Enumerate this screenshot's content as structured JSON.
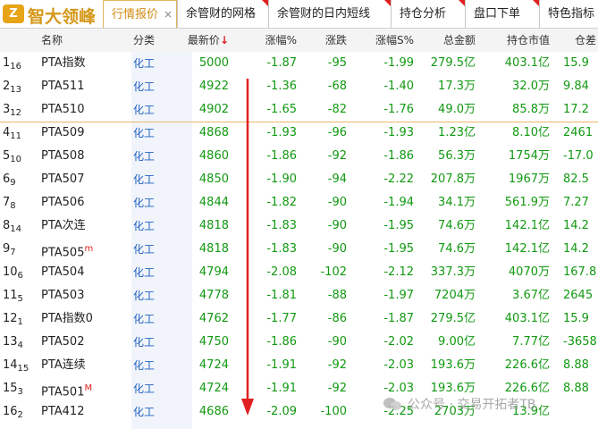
{
  "app": {
    "logo_glyph": "Z",
    "logo_text": "智大领峰"
  },
  "tabs": [
    {
      "label": "行情报价",
      "active": true,
      "close": "×"
    },
    {
      "label": "余管财的网格",
      "active": false
    },
    {
      "label": "余管财的日内短线",
      "active": false
    },
    {
      "label": "持仓分析",
      "active": false
    },
    {
      "label": "盘口下单",
      "active": false
    },
    {
      "label": "特色指标",
      "active": false
    }
  ],
  "columns": {
    "name": "名称",
    "category": "分类",
    "price": "最新价",
    "price_sort": "↓",
    "change_pct": "涨幅%",
    "change": "涨跌",
    "change_pct_s": "涨幅S%",
    "amount": "总金额",
    "position_value": "持仓市值",
    "open_diff": "仓差"
  },
  "rows": [
    {
      "idx": "1",
      "sub": "16",
      "name": "PTA指数",
      "sup": "",
      "cat": "化工",
      "price": "5000",
      "chg_pct": "-1.87",
      "chg": "-95",
      "chg_pct_s": "-1.99",
      "amount": "279.5亿",
      "pos_value": "403.1亿",
      "open_diff": "15.9"
    },
    {
      "idx": "2",
      "sub": "13",
      "name": "PTA511",
      "sup": "",
      "cat": "化工",
      "price": "4922",
      "chg_pct": "-1.36",
      "chg": "-68",
      "chg_pct_s": "-1.40",
      "amount": "17.3万",
      "pos_value": "32.0万",
      "open_diff": "9.84"
    },
    {
      "idx": "3",
      "sub": "12",
      "name": "PTA510",
      "sup": "",
      "cat": "化工",
      "price": "4902",
      "chg_pct": "-1.65",
      "chg": "-82",
      "chg_pct_s": "-1.76",
      "amount": "49.0万",
      "pos_value": "85.8万",
      "open_diff": "17.2"
    },
    {
      "idx": "4",
      "sub": "11",
      "name": "PTA509",
      "sup": "",
      "cat": "化工",
      "price": "4868",
      "chg_pct": "-1.93",
      "chg": "-96",
      "chg_pct_s": "-1.93",
      "amount": "1.23亿",
      "pos_value": "8.10亿",
      "open_diff": "2461"
    },
    {
      "idx": "5",
      "sub": "10",
      "name": "PTA508",
      "sup": "",
      "cat": "化工",
      "price": "4860",
      "chg_pct": "-1.86",
      "chg": "-92",
      "chg_pct_s": "-1.86",
      "amount": "56.3万",
      "pos_value": "1754万",
      "open_diff": "-17.0"
    },
    {
      "idx": "6",
      "sub": "9",
      "name": "PTA507",
      "sup": "",
      "cat": "化工",
      "price": "4850",
      "chg_pct": "-1.90",
      "chg": "-94",
      "chg_pct_s": "-2.22",
      "amount": "207.8万",
      "pos_value": "1967万",
      "open_diff": "82.5"
    },
    {
      "idx": "7",
      "sub": "8",
      "name": "PTA506",
      "sup": "",
      "cat": "化工",
      "price": "4844",
      "chg_pct": "-1.82",
      "chg": "-90",
      "chg_pct_s": "-1.94",
      "amount": "34.1万",
      "pos_value": "561.9万",
      "open_diff": "7.27"
    },
    {
      "idx": "8",
      "sub": "14",
      "name": "PTA次连",
      "sup": "",
      "cat": "化工",
      "price": "4818",
      "chg_pct": "-1.83",
      "chg": "-90",
      "chg_pct_s": "-1.95",
      "amount": "74.6万",
      "pos_value": "142.1亿",
      "open_diff": "14.2"
    },
    {
      "idx": "9",
      "sub": "7",
      "name": "PTA505",
      "sup": "m",
      "cat": "化工",
      "price": "4818",
      "chg_pct": "-1.83",
      "chg": "-90",
      "chg_pct_s": "-1.95",
      "amount": "74.6万",
      "pos_value": "142.1亿",
      "open_diff": "14.2"
    },
    {
      "idx": "10",
      "sub": "6",
      "name": "PTA504",
      "sup": "",
      "cat": "化工",
      "price": "4794",
      "chg_pct": "-2.08",
      "chg": "-102",
      "chg_pct_s": "-2.12",
      "amount": "337.3万",
      "pos_value": "4070万",
      "open_diff": "167.8"
    },
    {
      "idx": "11",
      "sub": "5",
      "name": "PTA503",
      "sup": "",
      "cat": "化工",
      "price": "4778",
      "chg_pct": "-1.81",
      "chg": "-88",
      "chg_pct_s": "-1.97",
      "amount": "7204万",
      "pos_value": "3.67亿",
      "open_diff": "2645"
    },
    {
      "idx": "12",
      "sub": "1",
      "name": "PTA指数0",
      "sup": "",
      "cat": "化工",
      "price": "4762",
      "chg_pct": "-1.77",
      "chg": "-86",
      "chg_pct_s": "-1.87",
      "amount": "279.5亿",
      "pos_value": "403.1亿",
      "open_diff": "15.9"
    },
    {
      "idx": "13",
      "sub": "4",
      "name": "PTA502",
      "sup": "",
      "cat": "化工",
      "price": "4750",
      "chg_pct": "-1.86",
      "chg": "-90",
      "chg_pct_s": "-2.02",
      "amount": "9.00亿",
      "pos_value": "7.77亿",
      "open_diff": "-3658"
    },
    {
      "idx": "14",
      "sub": "15",
      "name": "PTA连续",
      "sup": "",
      "cat": "化工",
      "price": "4724",
      "chg_pct": "-1.91",
      "chg": "-92",
      "chg_pct_s": "-2.03",
      "amount": "193.6万",
      "pos_value": "226.6亿",
      "open_diff": "8.88"
    },
    {
      "idx": "15",
      "sub": "3",
      "name": "PTA501",
      "sup": "M",
      "cat": "化工",
      "price": "4724",
      "chg_pct": "-1.91",
      "chg": "-92",
      "chg_pct_s": "-2.03",
      "amount": "193.6万",
      "pos_value": "226.6亿",
      "open_diff": "8.88"
    },
    {
      "idx": "16",
      "sub": "2",
      "name": "PTA412",
      "sup": "",
      "cat": "化工",
      "price": "4686",
      "chg_pct": "-2.09",
      "chg": "-100",
      "chg_pct_s": "-2.25",
      "amount": "2703万",
      "pos_value": "13.9亿",
      "open_diff": ""
    }
  ],
  "watermark": "公众号 · 交易开拓者TB",
  "colors": {
    "negative": "#119911",
    "category": "#1f5fbf",
    "accent": "#d08a10",
    "arrow": "#e02020"
  }
}
